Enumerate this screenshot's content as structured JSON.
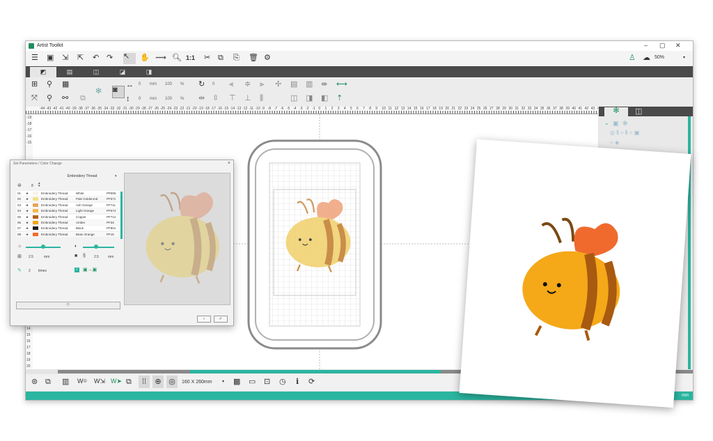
{
  "window": {
    "title": "Artist Toolkit",
    "controls": [
      "–",
      "▢",
      "✕"
    ]
  },
  "toolbar_top": {
    "one_to_one": "1:1",
    "zoom": "50%"
  },
  "toolbar_second": {
    "width_value": "0",
    "width_unit": "mm",
    "width_pct": "100",
    "pct_symbol": "%",
    "height_value": "0",
    "height_unit": "mm",
    "height_pct": "100",
    "rotate_value": "0"
  },
  "ruler_labels": [
    "-44",
    "-43",
    "-42",
    "-41",
    "-40",
    "-39",
    "-38",
    "-37",
    "-36",
    "-35",
    "-34",
    "-33",
    "-32",
    "-31",
    "-30",
    "-29",
    "-28",
    "-27",
    "-26",
    "-25",
    "-24",
    "-23",
    "-22",
    "-21",
    "-20",
    "-19",
    "-18",
    "-17",
    "-16",
    "-15",
    "-14",
    "-13",
    "-12",
    "-11",
    "-10",
    "-9",
    "-8",
    "-7",
    "-6",
    "-5",
    "-4",
    "-3",
    "-2",
    "-1",
    "0",
    "1",
    "2",
    "3",
    "4",
    "5",
    "6",
    "7",
    "8",
    "9",
    "10",
    "11",
    "12",
    "13",
    "14",
    "15",
    "16",
    "17",
    "18",
    "19",
    "20",
    "21",
    "22",
    "23",
    "24",
    "25",
    "26",
    "27",
    "28",
    "29",
    "30",
    "31",
    "32",
    "33",
    "34",
    "35",
    "36",
    "37",
    "38",
    "39",
    "40",
    "41",
    "42",
    "43",
    "44"
  ],
  "vruler_top": [
    "-19",
    "-18",
    "-17",
    "-16",
    "-15"
  ],
  "vruler_bottom": [
    "14",
    "15",
    "16",
    "17",
    "18",
    "19",
    "20"
  ],
  "bottom": {
    "hoop_size": "160 X 260mm"
  },
  "status": {
    "right": "mm"
  },
  "dialog": {
    "title": "Set Parameters / Color Change",
    "thread_type": "Embroidery Thread",
    "count": "8",
    "threads": [
      {
        "n": "01",
        "type": "Embroidery Thread",
        "name": "White",
        "code": "PP805",
        "color": "#f7f3ea"
      },
      {
        "n": "02",
        "type": "Embroidery Thread",
        "name": "Pale Goldenrod",
        "code": "PF571",
        "color": "#f1e18a"
      },
      {
        "n": "03",
        "type": "Embroidery Thread",
        "name": "Ash Orange",
        "code": "PF711",
        "color": "#e6a35a"
      },
      {
        "n": "04",
        "type": "Embroidery Thread",
        "name": "Light Orange",
        "code": "PF574",
        "color": "#f4b84a"
      },
      {
        "n": "05",
        "type": "Embroidery Thread",
        "name": "Copper",
        "code": "PF712",
        "color": "#b0631e"
      },
      {
        "n": "06",
        "type": "Embroidery Thread",
        "name": "Amber",
        "code": "PF33",
        "color": "#f2a418"
      },
      {
        "n": "07",
        "type": "Embroidery Thread",
        "name": "Black",
        "code": "PF801",
        "color": "#1e1e1e"
      },
      {
        "n": "08",
        "type": "Embroidery Thread",
        "name": "Bean Orange",
        "code": "PF15",
        "color": "#f06a2e"
      }
    ],
    "spacing_value": "2.5",
    "spacing_unit": "mm",
    "stitch_value": "2.5",
    "stitch_unit": "mm",
    "times_value": "2",
    "times_label": "times"
  },
  "colors": {
    "accent": "#2bb5a0",
    "tabbar": "#4a4a4a"
  }
}
